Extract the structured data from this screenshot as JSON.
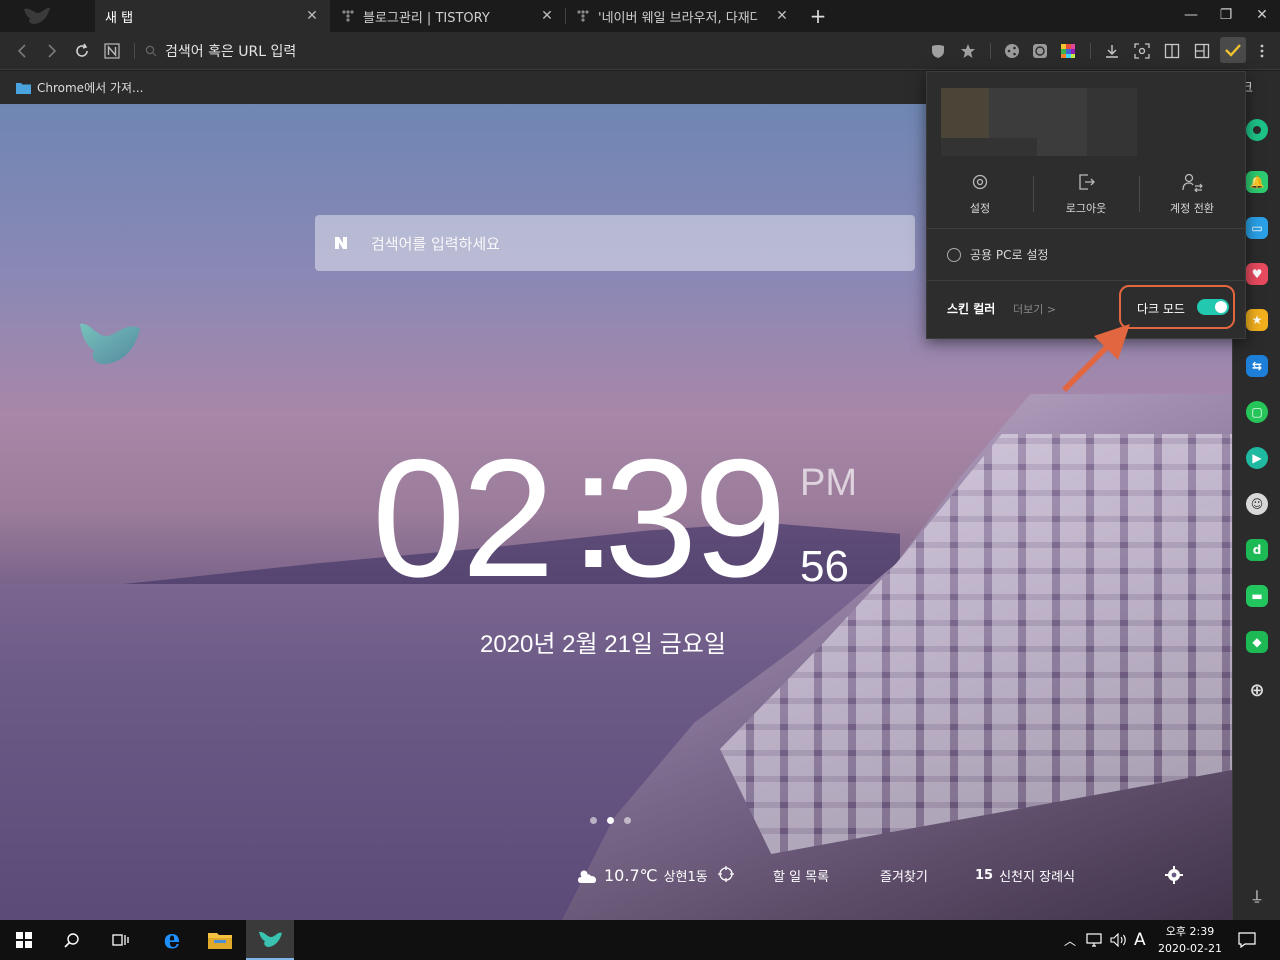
{
  "tabs": [
    {
      "label": "새 탭"
    },
    {
      "label": "블로그관리 | TISTORY"
    },
    {
      "label": "'네이버 웨일 브라우저, 다재다능"
    }
  ],
  "address_bar": {
    "placeholder": "검색어 혹은 URL 입력"
  },
  "bookmarks": [
    {
      "label": "Chrome에서 가져..."
    }
  ],
  "new_tab_page": {
    "search_placeholder": "검색어를 입력하세요",
    "clock": {
      "hours": "02",
      "minutes": "39",
      "ampm": "PM",
      "seconds": "56"
    },
    "date": "2020년 2월 21일 금요일",
    "weather": {
      "temp": "10.7℃",
      "location": "상현1동"
    },
    "links": [
      {
        "label": "할 일 목록"
      },
      {
        "label": "즐겨찾기"
      }
    ],
    "news": {
      "rank": "15",
      "title": "신천지 장례식"
    },
    "slide_dots": {
      "count": 3,
      "active": 1
    }
  },
  "profile_popup": {
    "actions": [
      {
        "label": "설정",
        "icon": "gear-icon"
      },
      {
        "label": "로그아웃",
        "icon": "logout-icon"
      },
      {
        "label": "계정 전환",
        "icon": "switch-account-icon"
      }
    ],
    "public_pc_label": "공용 PC로 설정",
    "skin_color_label": "스킨 컬러",
    "more_label": "더보기 >",
    "dark_mode_label": "다크 모드",
    "dark_mode_on": true
  },
  "sidebar_partial_label": "크",
  "colors": {
    "accent_teal": "#22c8b0",
    "highlight_orange": "#e26640"
  },
  "taskbar": {
    "time": "오후 2:39",
    "date": "2020-02-21",
    "ime": "A"
  }
}
